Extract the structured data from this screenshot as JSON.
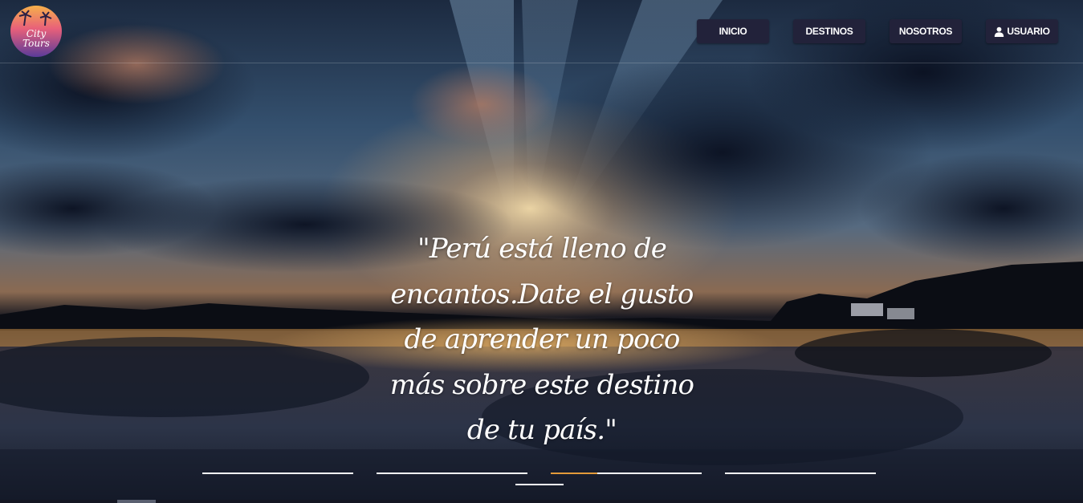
{
  "brand": {
    "logo_text_line1": "City",
    "logo_text_line2": "Tours"
  },
  "nav": {
    "items": [
      {
        "label": "INICIO"
      },
      {
        "label": "DESTINOS"
      },
      {
        "label": "NOSOTROS"
      },
      {
        "label": "USUARIO",
        "icon": "user-icon"
      }
    ]
  },
  "hero": {
    "quote": "\"Perú está lleno de encantos.Date el gusto de aprender un poco más sobre este destino de tu país.\""
  },
  "carousel": {
    "indicators": [
      {
        "progress": 0
      },
      {
        "progress": 0
      },
      {
        "progress": 0.31
      },
      {
        "progress": 0
      },
      {
        "progress": 0
      }
    ]
  },
  "colors": {
    "nav_button_bg": "#22223a",
    "indicator": "#ffffff",
    "indicator_progress": "#e39a3a"
  }
}
